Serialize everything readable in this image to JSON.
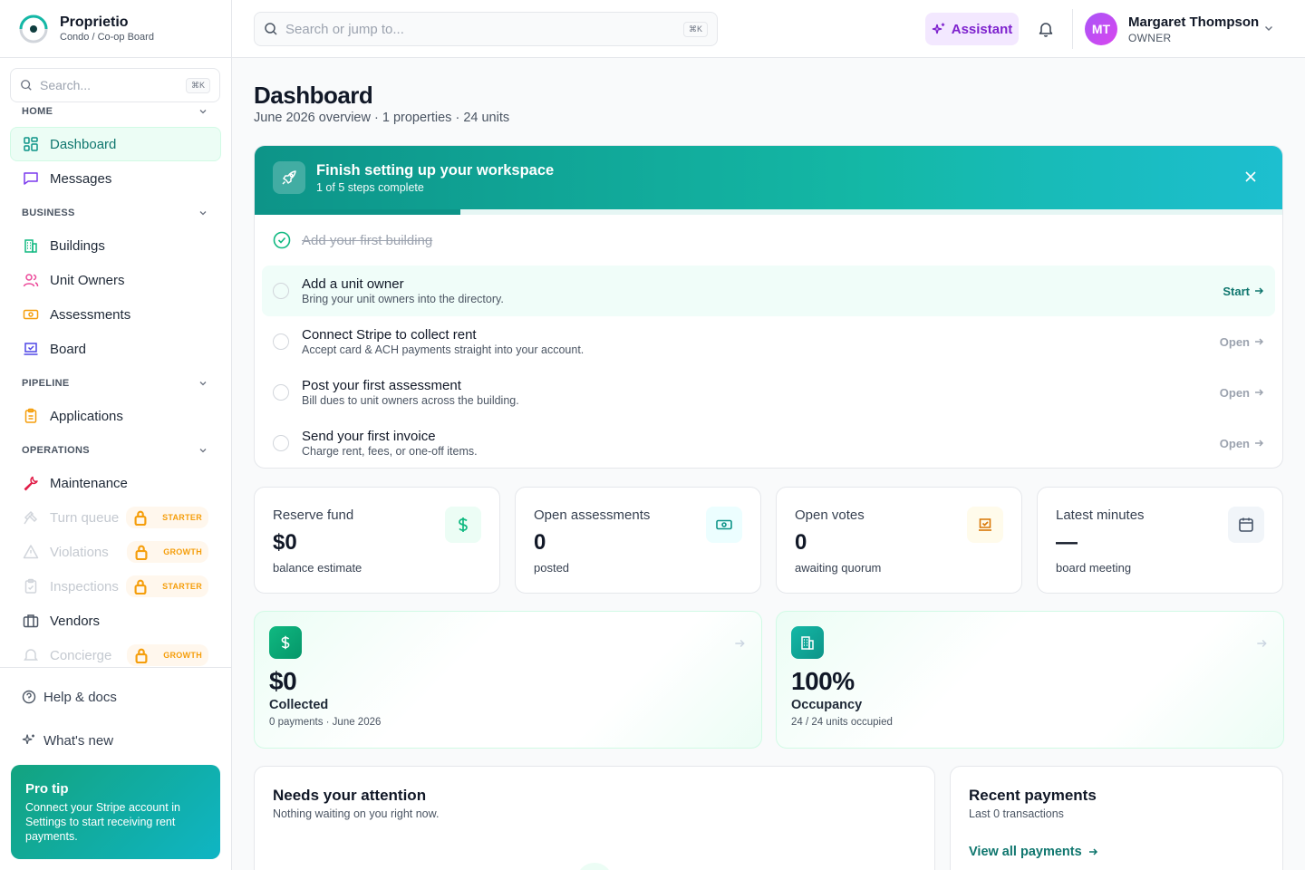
{
  "brand": {
    "name": "Proprietio",
    "subtitle": "Condo / Co-op Board"
  },
  "sidebar": {
    "search_placeholder": "Search...",
    "search_kbd": "⌘K",
    "sections": {
      "home": "HOME",
      "business": "BUSINESS",
      "pipeline": "PIPELINE",
      "operations": "OPERATIONS"
    },
    "items": {
      "dashboard": "Dashboard",
      "messages": "Messages",
      "buildings": "Buildings",
      "unit_owners": "Unit Owners",
      "assessments": "Assessments",
      "board": "Board",
      "applications": "Applications",
      "maintenance": "Maintenance",
      "turn_queue": "Turn queue",
      "violations": "Violations",
      "inspections": "Inspections",
      "vendors": "Vendors",
      "concierge": "Concierge"
    },
    "badges": {
      "turn_queue": "STARTER",
      "violations": "GROWTH",
      "inspections": "STARTER",
      "concierge": "GROWTH"
    },
    "help": "Help & docs",
    "whats_new": "What's new",
    "protip": {
      "title": "Pro tip",
      "body": "Connect your Stripe account in Settings to start receiving rent payments."
    }
  },
  "topbar": {
    "search_placeholder": "Search or jump to...",
    "search_kbd": "⌘K",
    "assistant": "Assistant",
    "user": {
      "initials": "MT",
      "name": "Margaret Thompson",
      "role": "OWNER"
    }
  },
  "page": {
    "title": "Dashboard",
    "subtitle": "June 2026 overview · 1 properties · 24 units"
  },
  "setup": {
    "title": "Finish setting up your workspace",
    "count": "1 of 5 steps complete",
    "progress": 0.2,
    "steps": [
      {
        "title": "Add your first building",
        "desc": "",
        "action": ""
      },
      {
        "title": "Add a unit owner",
        "desc": "Bring your unit owners into the directory.",
        "action": "Start"
      },
      {
        "title": "Connect Stripe to collect rent",
        "desc": "Accept card & ACH payments straight into your account.",
        "action": "Open"
      },
      {
        "title": "Post your first assessment",
        "desc": "Bill dues to unit owners across the building.",
        "action": "Open"
      },
      {
        "title": "Send your first invoice",
        "desc": "Charge rent, fees, or one-off items.",
        "action": "Open"
      }
    ]
  },
  "kpis": [
    {
      "label": "Reserve fund",
      "value": "$0",
      "sub": "balance estimate"
    },
    {
      "label": "Open assessments",
      "value": "0",
      "sub": "posted"
    },
    {
      "label": "Open votes",
      "value": "0",
      "sub": "awaiting quorum"
    },
    {
      "label": "Latest minutes",
      "value": "—",
      "sub": "board meeting"
    }
  ],
  "big_cards": [
    {
      "value": "$0",
      "label": "Collected",
      "sub": "0 payments · June 2026"
    },
    {
      "value": "100%",
      "label": "Occupancy",
      "sub": "24 / 24 units occupied"
    }
  ],
  "attention": {
    "title": "Needs your attention",
    "sub": "Nothing waiting on you right now."
  },
  "payments": {
    "title": "Recent payments",
    "sub": "Last 0 transactions",
    "link": "View all payments"
  },
  "colors": {
    "accent": "#0d9488",
    "assistant": "#7e22ce",
    "lock": "#f59e0b"
  }
}
